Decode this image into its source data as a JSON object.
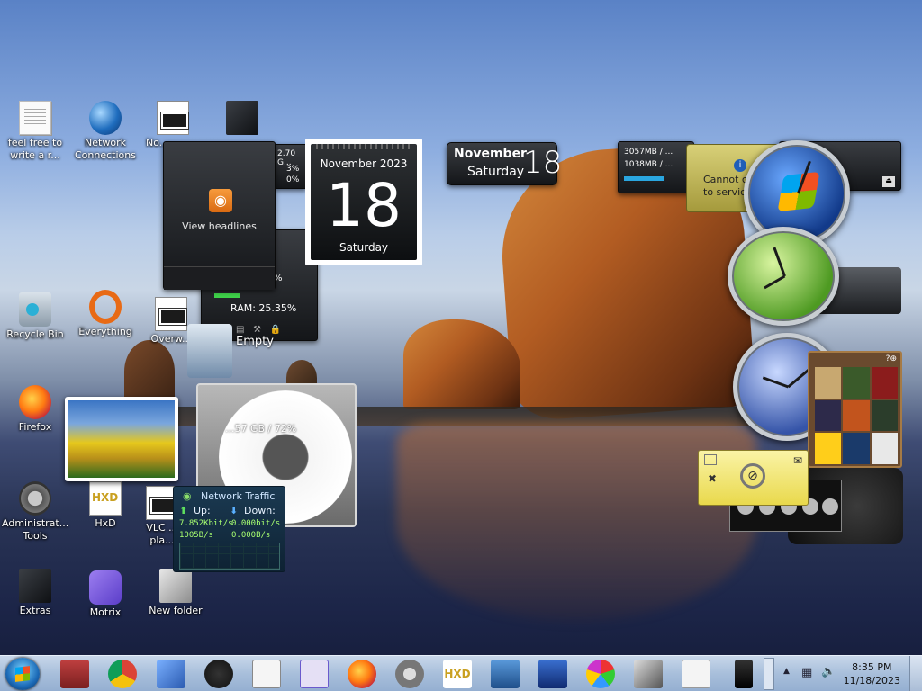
{
  "desktop": {
    "icons": [
      {
        "label": "feel free to write a r...",
        "icon": "text-document-icon"
      },
      {
        "label": "Network Connections",
        "icon": "network-icon"
      },
      {
        "label": "No...",
        "icon": "notepad-icon"
      },
      {
        "label": "Recycle Bin",
        "icon": "recycle-bin-icon"
      },
      {
        "label": "Everything",
        "icon": "everything-icon"
      },
      {
        "label": "Overw...",
        "icon": "app-icon"
      },
      {
        "label": "Firefox",
        "icon": "firefox-icon"
      },
      {
        "label": "Administrat... Tools",
        "icon": "admin-tools-icon"
      },
      {
        "label": "HxD",
        "icon": "hxd-icon"
      },
      {
        "label": "VLC ... pla...",
        "icon": "vlc-icon"
      },
      {
        "label": "Extras",
        "icon": "folder-icon"
      },
      {
        "label": "Motrix",
        "icon": "motrix-icon"
      },
      {
        "label": "New folder",
        "icon": "folder-icon"
      }
    ]
  },
  "gadgets": {
    "feed": {
      "label": "View headlines"
    },
    "calendar": {
      "month_year": "November 2023",
      "day": "18",
      "weekday": "Saturday"
    },
    "date_small": {
      "month": "November",
      "weekday": "Saturday",
      "day": "18"
    },
    "cpu_meter": {
      "disk": "2.70 G...",
      "cpu": "3%",
      "cpu2": "0%",
      "time": "PM",
      "ram": "RAM: 25.35%",
      "pct": "%"
    },
    "memory": {
      "line1": "3057MB / ...",
      "line2": "1038MB / ..."
    },
    "weather": {
      "line1": "Cannot c...",
      "line2": "to servic..."
    },
    "recycle": {
      "label": "Empty"
    },
    "disc": {
      "label": "...57 GB / 72%"
    },
    "network": {
      "title": "Network Traffic",
      "up_label": "Up:",
      "down_label": "Down:",
      "up_rate_bits": "7.852Kbit/s",
      "down_rate_bits": "0.000bit/s",
      "up_rate_bytes": "1005B/s",
      "down_rate_bytes": "0.000B/s"
    }
  },
  "taskbar": {
    "pinned": [
      "store-icon",
      "chrome-icon",
      "tools-icon",
      "paint-icon",
      "solitaire-icon",
      "app-icon",
      "firefox-icon",
      "settings-icon",
      "hxd-icon",
      "remote-desktop-icon",
      "network-icon",
      "paint-palette-icon",
      "photo-viewer-icon",
      "notepad-icon",
      "card-reader-icon"
    ],
    "time": "8:35 PM",
    "date": "11/18/2023"
  }
}
